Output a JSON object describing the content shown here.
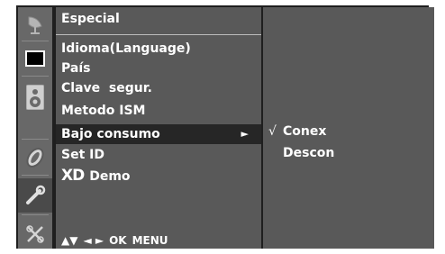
{
  "sidebar": {
    "icons": [
      "satellite-dish-icon",
      "screen-icon",
      "speaker-icon",
      "time-icon",
      "wrench-icon",
      "option-icon"
    ]
  },
  "menu": {
    "title": "Especial",
    "items": [
      {
        "label": "Idioma(Language)"
      },
      {
        "label": "País"
      },
      {
        "label": "Clave  segur."
      },
      {
        "label": "Metodo ISM"
      },
      {
        "label": "Bajo consumo",
        "arrow": "►"
      },
      {
        "label": "Set ID"
      },
      {
        "label": "Demo",
        "prefix": "XD"
      }
    ]
  },
  "submenu": {
    "options": [
      {
        "label": "Conex",
        "check": "√"
      },
      {
        "label": "Descon",
        "check": ""
      }
    ]
  },
  "footer": {
    "updown": "▲▼",
    "leftright": "◄ ►",
    "ok": "OK",
    "menu": "MENU"
  },
  "colors": {
    "panel": "#595959",
    "sidebar": "#686868",
    "selected": "#262626",
    "text": "#ffffff"
  }
}
